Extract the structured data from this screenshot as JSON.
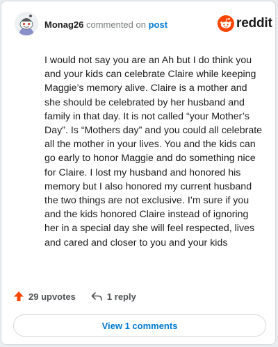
{
  "header": {
    "username": "Monag26",
    "commented_on": "commented on",
    "post_link": "post",
    "brand": "reddit"
  },
  "comment": {
    "text": "I would not say you are an Ah but I do think you and your kids can celebrate Claire while keeping Maggie’s memory alive. Claire is a mother and she should be celebrated by her husband and family in that day. It is not called “your Mother’s Day”. Is “Mothers day” and you could all celebrate all the mother in your lives. You and the kids can go early to honor Maggie and do something nice for Claire. I lost my husband and honored his memory but I also honored my current husband the two things are not exclusive. I’m sure if you and the kids honored Claire instead of ignoring her in a special day she will feel respected, lives and cared and closer to you and your kids"
  },
  "actions": {
    "upvotes": "29 upvotes",
    "replies": "1 reply"
  },
  "footer": {
    "view_comments": "View 1 comments"
  },
  "colors": {
    "upvote": "#ff4500",
    "link": "#0079d3",
    "brand": "#ff4500"
  }
}
